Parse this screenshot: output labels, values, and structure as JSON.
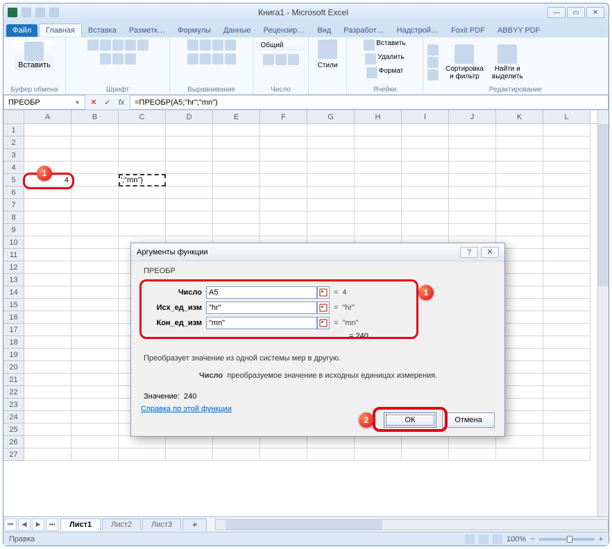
{
  "window": {
    "title": "Книга1  -  Microsoft Excel"
  },
  "ribbon": {
    "tabs": [
      "Файл",
      "Главная",
      "Вставка",
      "Разметк…",
      "Формулы",
      "Данные",
      "Рецензир…",
      "Вид",
      "Разработ…",
      "Надстрой…",
      "Foxit PDF",
      "ABBYY PDF"
    ],
    "active_tab_index": 1,
    "groups": {
      "clipboard": {
        "label": "Буфер обмена",
        "paste": "Вставить"
      },
      "font": {
        "label": "Шрифт"
      },
      "alignment": {
        "label": "Выравнивание"
      },
      "number": {
        "label": "Число",
        "format": "Общий"
      },
      "styles": {
        "label": "",
        "styles_btn": "Стили"
      },
      "cells": {
        "label": "Ячейки",
        "insert": "Вставить",
        "delete": "Удалить",
        "format": "Формат"
      },
      "editing": {
        "label": "Редактирование",
        "sort": "Сортировка\nи фильтр",
        "find": "Найти и\nвыделить"
      }
    }
  },
  "namebox": "ПРЕОБР",
  "formula": "=ПРЕОБР(A5;\"hr\";\"mn\")",
  "columns": [
    "A",
    "B",
    "C",
    "D",
    "E",
    "F",
    "G",
    "H",
    "I",
    "J",
    "K",
    "L"
  ],
  "rows_count": 27,
  "cell_a5": "4",
  "cell_c5_display": "';\"mn\")",
  "sheets": {
    "s1": "Лист1",
    "s2": "Лист2",
    "s3": "Лист3"
  },
  "status": {
    "mode": "Правка",
    "zoom": "100%"
  },
  "dialog": {
    "title": "Аргументы функции",
    "func_name": "ПРЕОБР",
    "args": [
      {
        "label": "Число",
        "value": "A5",
        "result": "4"
      },
      {
        "label": "Исх_ед_изм",
        "value": "\"hr\"",
        "result": "\"hr\""
      },
      {
        "label": "Кон_ед_изм",
        "value": "\"mn\"",
        "result": "\"mn\""
      }
    ],
    "calc_result_inline": "=  240",
    "description_line1": "Преобразует значение из одной системы мер в другую.",
    "description_arg_name": "Число",
    "description_arg_text": "преобразуемое значение в исходных единицах измерения.",
    "value_label": "Значение:",
    "value_result": "240",
    "help_link": "Справка по этой функции",
    "ok": "ОК",
    "cancel": "Отмена"
  },
  "badges": {
    "b1": "1",
    "b1b": "1",
    "b2": "2"
  }
}
